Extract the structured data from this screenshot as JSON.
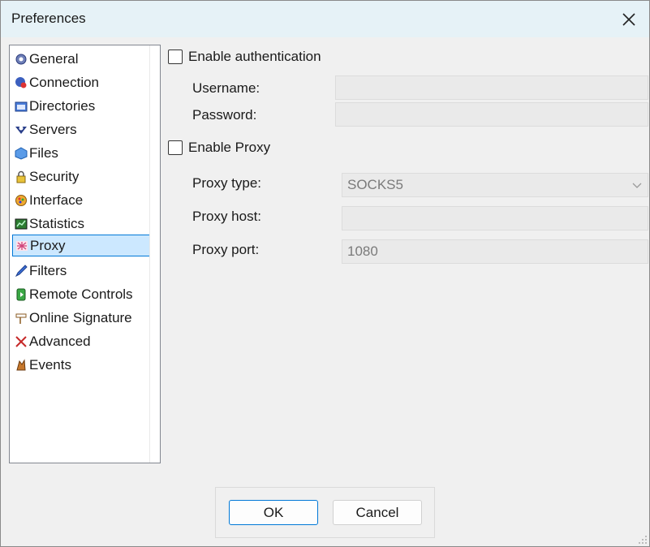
{
  "window": {
    "title": "Preferences"
  },
  "nav": {
    "items": [
      {
        "label": "General",
        "icon": "gear-icon"
      },
      {
        "label": "Connection",
        "icon": "connection-icon"
      },
      {
        "label": "Directories",
        "icon": "directories-icon"
      },
      {
        "label": "Servers",
        "icon": "servers-icon"
      },
      {
        "label": "Files",
        "icon": "files-icon"
      },
      {
        "label": "Security",
        "icon": "lock-icon"
      },
      {
        "label": "Interface",
        "icon": "interface-icon"
      },
      {
        "label": "Statistics",
        "icon": "statistics-icon"
      },
      {
        "label": "Proxy",
        "icon": "proxy-icon"
      },
      {
        "label": "Filters",
        "icon": "filters-icon"
      },
      {
        "label": "Remote Controls",
        "icon": "remote-controls-icon"
      },
      {
        "label": "Online Signature",
        "icon": "signature-icon"
      },
      {
        "label": "Advanced",
        "icon": "advanced-icon"
      },
      {
        "label": "Events",
        "icon": "events-icon"
      }
    ],
    "selected": "Proxy"
  },
  "proxy": {
    "enable_auth_label": "Enable authentication",
    "enable_auth_checked": false,
    "username_label": "Username:",
    "username_value": "",
    "password_label": "Password:",
    "password_value": "",
    "enable_proxy_label": "Enable Proxy",
    "enable_proxy_checked": false,
    "proxy_type_label": "Proxy type:",
    "proxy_type_value": "SOCKS5",
    "proxy_host_label": "Proxy host:",
    "proxy_host_value": "",
    "proxy_port_label": "Proxy port:",
    "proxy_port_value": "1080"
  },
  "buttons": {
    "ok": "OK",
    "cancel": "Cancel"
  },
  "colors": {
    "selection_bg": "#cce8ff",
    "selection_border": "#0078d7",
    "titlebar": "#e6f2f7"
  }
}
